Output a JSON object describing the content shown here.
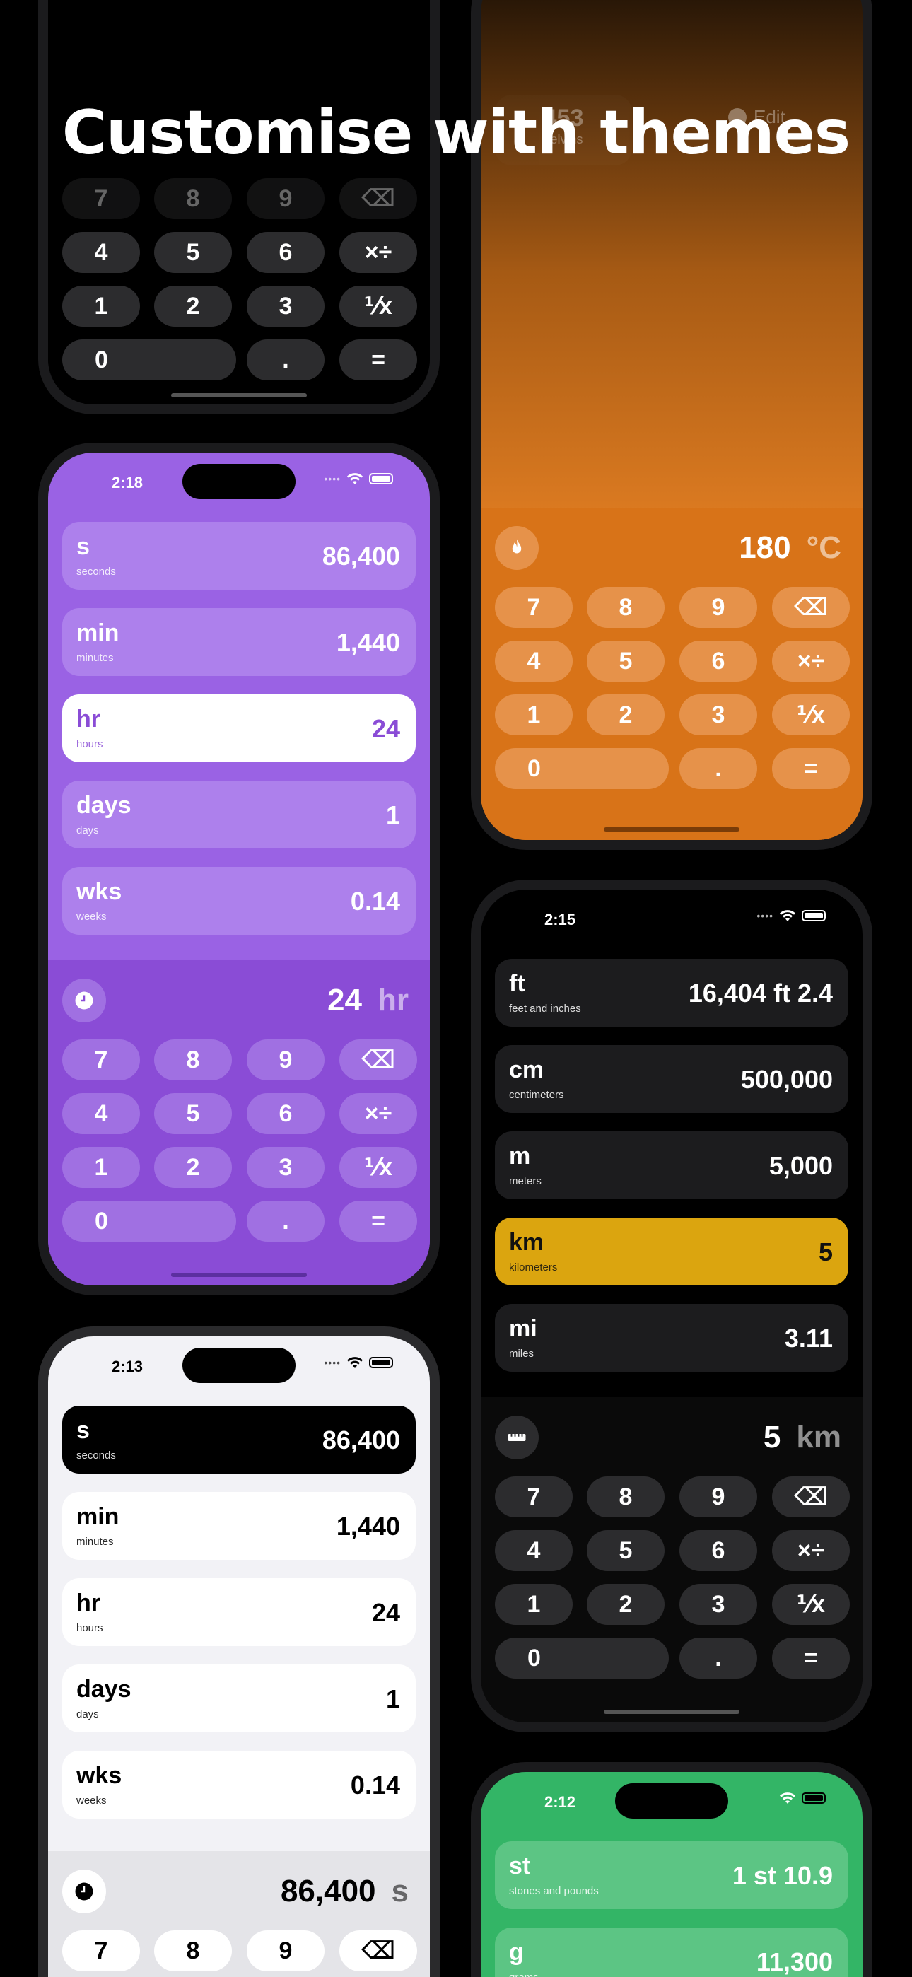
{
  "headline": "Customise with themes",
  "keypad_keys": [
    "7",
    "8",
    "9",
    "⌫",
    "4",
    "5",
    "6",
    "×÷",
    "1",
    "2",
    "3",
    "⅟x",
    "0",
    ".",
    "="
  ],
  "purple_phone": {
    "time": "2:18",
    "rows": [
      {
        "abbr": "s",
        "full": "seconds",
        "value": "86,400"
      },
      {
        "abbr": "min",
        "full": "minutes",
        "value": "1,440"
      },
      {
        "abbr": "hr",
        "full": "hours",
        "value": "24"
      },
      {
        "abbr": "days",
        "full": "days",
        "value": "1"
      },
      {
        "abbr": "wks",
        "full": "weeks",
        "value": "0.14"
      }
    ],
    "display_value": "24",
    "display_unit": "hr"
  },
  "orange_phone": {
    "ghost_value": "453",
    "ghost_unit": "kelvins",
    "edit_label": "Edit",
    "display_value": "180",
    "display_unit": "°C"
  },
  "dark_phone": {
    "time": "2:15",
    "rows": [
      {
        "abbr": "ft",
        "full": "feet and inches",
        "value": "16,404 ft 2.4"
      },
      {
        "abbr": "cm",
        "full": "centimeters",
        "value": "500,000"
      },
      {
        "abbr": "m",
        "full": "meters",
        "value": "5,000"
      },
      {
        "abbr": "km",
        "full": "kilometers",
        "value": "5"
      },
      {
        "abbr": "mi",
        "full": "miles",
        "value": "3.11"
      }
    ],
    "display_value": "5",
    "display_unit": "km"
  },
  "light_phone": {
    "time": "2:13",
    "rows": [
      {
        "abbr": "s",
        "full": "seconds",
        "value": "86,400"
      },
      {
        "abbr": "min",
        "full": "minutes",
        "value": "1,440"
      },
      {
        "abbr": "hr",
        "full": "hours",
        "value": "24"
      },
      {
        "abbr": "days",
        "full": "days",
        "value": "1"
      },
      {
        "abbr": "wks",
        "full": "weeks",
        "value": "0.14"
      }
    ],
    "display_value": "86,400",
    "display_unit": "s"
  },
  "green_phone": {
    "time": "2:12",
    "rows": [
      {
        "abbr": "st",
        "full": "stones and pounds",
        "value": "1 st 10.9"
      },
      {
        "abbr": "g",
        "full": "grams",
        "value": "11,300"
      }
    ]
  },
  "colors": {
    "purple": "#9a62e4",
    "orange": "#d87318",
    "dark_selected": "#dba50f",
    "green": "#33b566"
  }
}
